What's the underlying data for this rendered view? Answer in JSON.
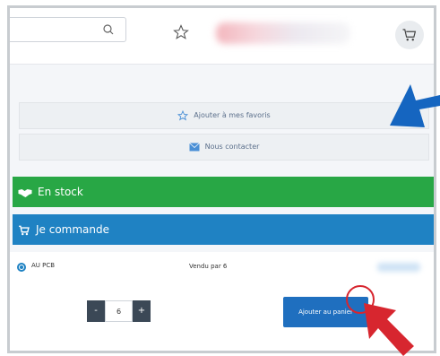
{
  "header": {
    "search": {
      "value": "",
      "placeholder": ""
    },
    "icons": [
      "search-icon",
      "star-icon",
      "cart-icon"
    ]
  },
  "actions": {
    "favorite_label": "Ajouter à mes favoris",
    "contact_label": "Nous contacter"
  },
  "stock": {
    "label": "En stock"
  },
  "order": {
    "label": "Je commande"
  },
  "offer": {
    "seller": "AU PCB",
    "sold_by": "Vendu par 6"
  },
  "purchase": {
    "minus": "-",
    "quantity": "6",
    "plus": "+",
    "add_to_cart_label": "Ajouter au panier"
  },
  "colors": {
    "stock_green": "#28a745",
    "order_blue": "#1f82c3",
    "button_blue": "#1f6fbf",
    "annotation_blue": "#1565c0",
    "annotation_red": "#d7262f"
  }
}
